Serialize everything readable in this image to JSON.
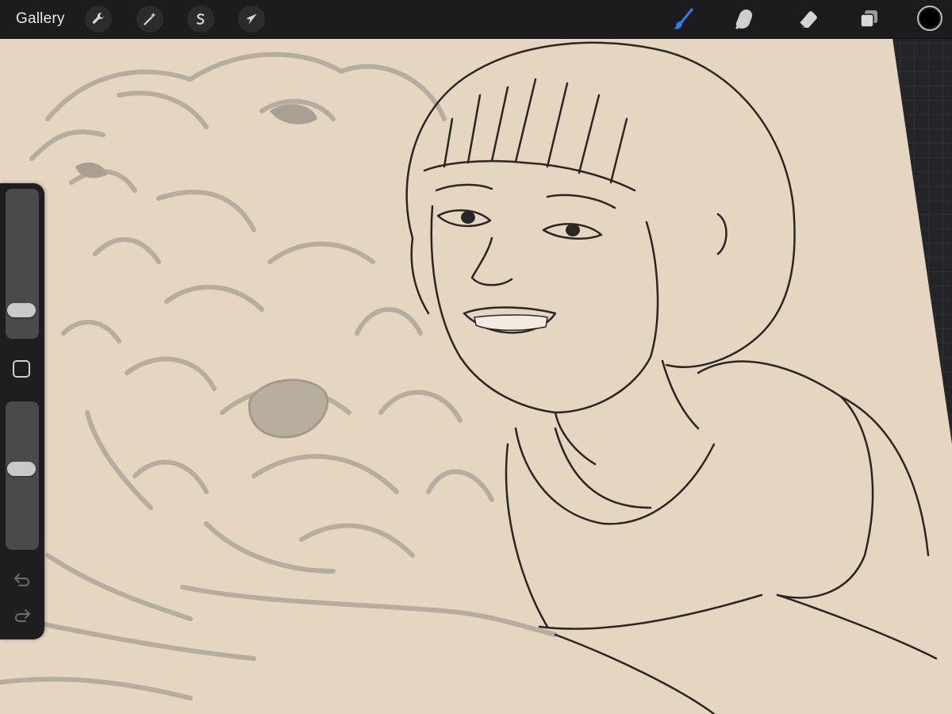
{
  "app": {
    "gallery_label": "Gallery"
  },
  "toolbar": {
    "left_tools": [
      {
        "name": "actions",
        "icon": "wrench-icon"
      },
      {
        "name": "adjustments",
        "icon": "magic-wand-icon"
      },
      {
        "name": "selection",
        "icon": "selection-s-icon"
      },
      {
        "name": "transform",
        "icon": "arrow-cursor-icon"
      }
    ],
    "right_tools": [
      {
        "name": "brush",
        "icon": "brush-icon",
        "active": true
      },
      {
        "name": "smudge",
        "icon": "smudge-finger-icon",
        "active": false
      },
      {
        "name": "eraser",
        "icon": "eraser-icon",
        "active": false
      },
      {
        "name": "layers",
        "icon": "layers-icon",
        "active": false
      }
    ],
    "current_color": "#000000"
  },
  "sidebar": {
    "brush_size_level": 0.15,
    "brush_opacity_level": 0.55,
    "modify_button_icon": "square-outline-icon",
    "undo_icon": "undo-arrow-icon",
    "redo_icon": "redo-arrow-icon"
  },
  "colors": {
    "accent": "#2f7cf6",
    "toolbar_bg": "#1c1c1e",
    "canvas_paper": "#e4d6c0",
    "sketch_light": "#b3ab9c",
    "ink": "#2a2623"
  }
}
